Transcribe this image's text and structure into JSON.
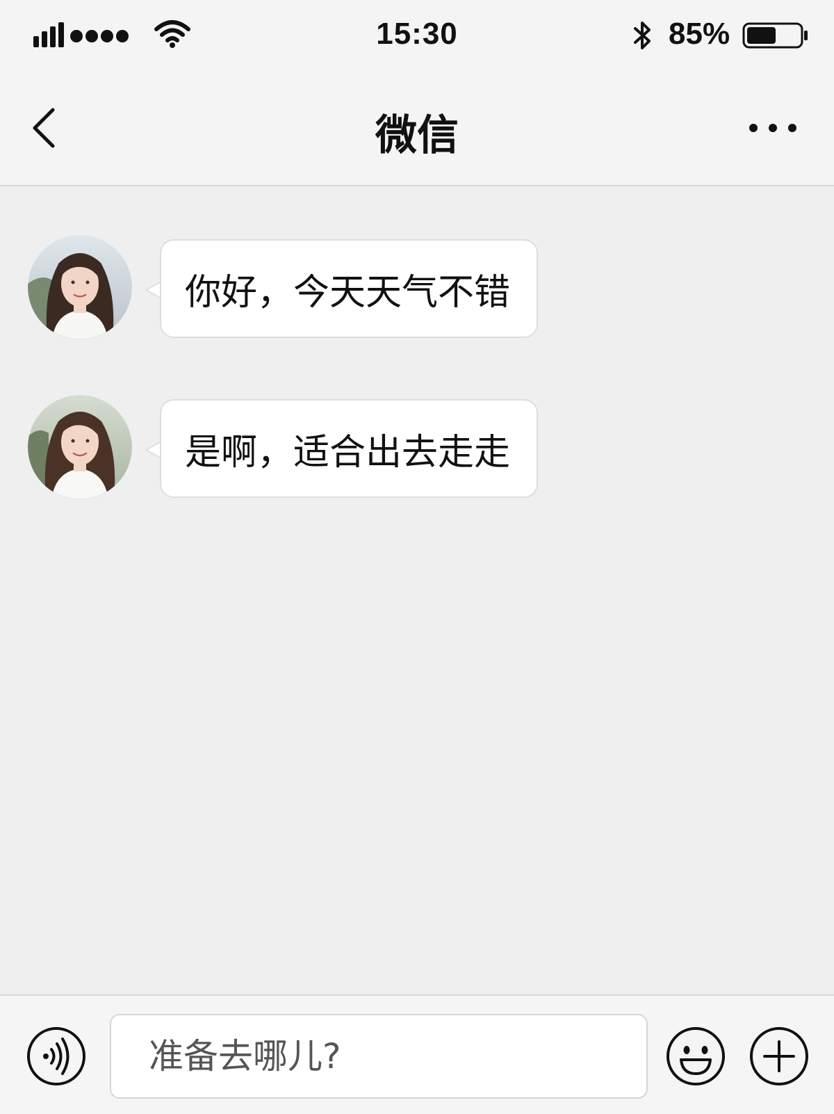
{
  "status_bar": {
    "time": "15:30",
    "battery_percent": "85%",
    "battery_level": 0.55,
    "icons": [
      "signal-bars-icon",
      "signal-dots-icon",
      "wifi-icon",
      "bluetooth-icon",
      "battery-icon"
    ]
  },
  "nav": {
    "title": "微信",
    "back_icon": "chevron-left-icon",
    "more_icon": "more-dots-icon"
  },
  "messages": [
    {
      "sender": "received",
      "text": "你好，今天天气不错"
    },
    {
      "sender": "received",
      "text": "是啊，适合出去走走"
    }
  ],
  "input_bar": {
    "placeholder": "准备去哪儿?",
    "voice_icon": "voice-icon",
    "emoji_icon": "emoji-icon",
    "add_icon": "plus-icon"
  },
  "colors": {
    "background": "#efefef",
    "bubble": "#ffffff",
    "bar": "#f4f4f4",
    "text": "#111111"
  }
}
